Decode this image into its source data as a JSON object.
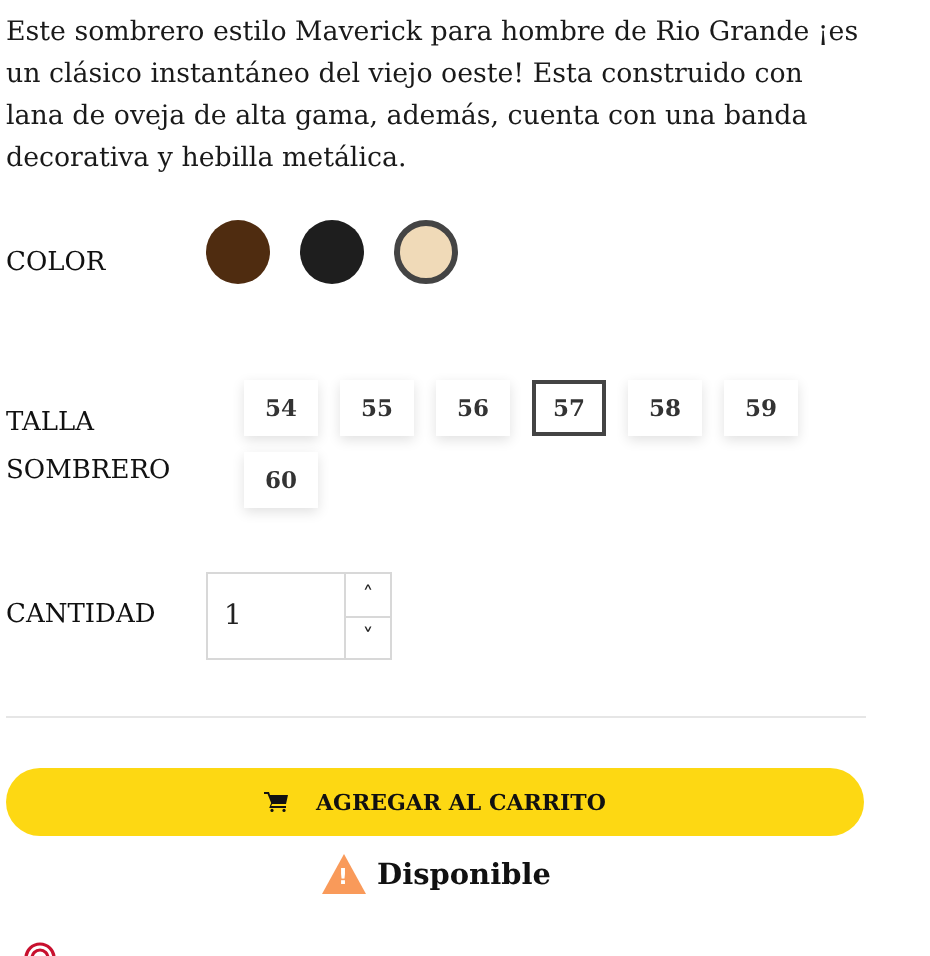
{
  "description": "Este sombrero estilo Maverick para hombre de Rio Grande ¡es un clásico instantáneo del viejo oeste! Esta construido con lana de oveja de alta gama, además, cuenta con una banda decorativa y hebilla metálica.",
  "color_option": {
    "label": "COLOR",
    "swatches": [
      {
        "color": "#4f2c10",
        "selected": false
      },
      {
        "color": "#1e1e1e",
        "selected": false
      },
      {
        "color": "#f0dab8",
        "selected": true
      }
    ]
  },
  "size_option": {
    "label": "TALLA SOMBRERO",
    "sizes": [
      {
        "label": "54",
        "selected": false
      },
      {
        "label": "55",
        "selected": false
      },
      {
        "label": "56",
        "selected": false
      },
      {
        "label": "57",
        "selected": true
      },
      {
        "label": "58",
        "selected": false
      },
      {
        "label": "59",
        "selected": false
      },
      {
        "label": "60",
        "selected": false
      }
    ]
  },
  "quantity": {
    "label": "CANTIDAD",
    "value": "1",
    "up": "˄",
    "down": "˅"
  },
  "add_to_cart": {
    "label": "AGREGAR AL CARRITO"
  },
  "availability": {
    "label": "Disponible",
    "icon": "!"
  }
}
